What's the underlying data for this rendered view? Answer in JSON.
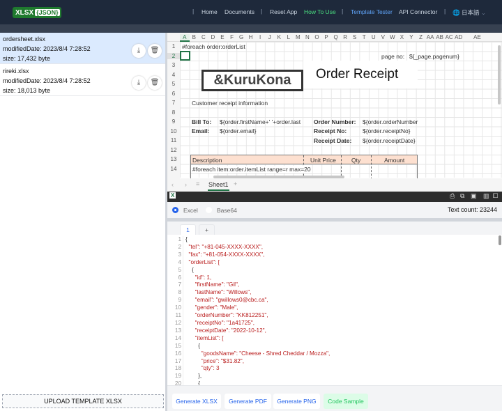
{
  "header": {
    "logo_main": "XLSX",
    "logo_badge": "{JSON}",
    "nav": [
      "Home",
      "Documents",
      "Reset App",
      "How To Use",
      "Template Tester",
      "API Connector"
    ],
    "language": "日本語",
    "colors": {
      "active": "#4ade80",
      "current": "#60a5fa"
    }
  },
  "files": [
    {
      "name": "ordersheet.xlsx",
      "modified": "modifiedDate: 2023/8/4 7:28:52",
      "size": "size: 17,432 byte",
      "selected": true
    },
    {
      "name": "rireki.xlsx",
      "modified": "modifiedDate: 2023/8/4 7:28:52",
      "size": "size: 18,013 byte",
      "selected": false
    }
  ],
  "upload_label": "UPLOAD TEMPLATE XLSX",
  "sheet": {
    "columns": [
      "A",
      "B",
      "C",
      "D",
      "E",
      "F",
      "G",
      "H",
      "I",
      "J",
      "K",
      "L",
      "M",
      "N",
      "O",
      "P",
      "Q",
      "R",
      "S",
      "T",
      "U",
      "V",
      "W",
      "X",
      "Y",
      "Z",
      "AA",
      "AB",
      "AC",
      "AD",
      "AE"
    ],
    "rows": [
      "1",
      "2",
      "3",
      "4",
      "5",
      "6",
      "7",
      "8",
      "9",
      "10",
      "11",
      "12",
      "13",
      "14"
    ],
    "cells": {
      "a1": "#foreach order:orderList",
      "page_no": "page no:",
      "page_num": "${_page.pagenum}",
      "brand": "&KuruKona",
      "title": "Order Receipt",
      "customer": "Customer receipt information",
      "bill_to": "Bill To:",
      "bill_to_val": "${order.firstName+' '+order.last",
      "email": "Email:",
      "email_val": "${order.email}",
      "order_number": "Order Number:",
      "order_number_val": "${order.orderNumber",
      "receipt_no": "Receipt No:",
      "receipt_no_val": "${order.receiptNo}",
      "receipt_date": "Receipt Date:",
      "receipt_date_val": "${order.receiptDate}"
    },
    "table_headers": [
      "Description",
      "Unit Price",
      "Qty",
      "Amount"
    ],
    "row14": "#foreach item:order.itemList range=r max=20",
    "tab": "Sheet1"
  },
  "output": {
    "options": [
      "Excel",
      "Base64"
    ],
    "selected": "Excel",
    "text_count": "Text count: 23244"
  },
  "editor": {
    "tabs": [
      "1",
      "+"
    ],
    "lines": [
      "{",
      "  \"tel\": \"+81-045-XXXX-XXXX\",",
      "  \"fax\": \"+81-054-XXXX-XXXX\",",
      "  \"orderList\": [",
      "    {",
      "      \"id\": 1,",
      "      \"firstName\": \"Gil\",",
      "      \"lastName\": \"Willows\",",
      "      \"email\": \"gwillows0@cbc.ca\",",
      "      \"gender\": \"Male\",",
      "      \"orderNumber\": \"KK812251\",",
      "      \"receiptNo\": \"1a41725\",",
      "      \"receiptDate\": \"2022-10-12\",",
      "      \"itemList\": [",
      "        {",
      "          \"goodsName\": \"Cheese - Shred Cheddar / Mozza\",",
      "          \"price\": \"$31.82\",",
      "          \"qty\": 3",
      "        },",
      "        {"
    ]
  },
  "actions": [
    "Generate XLSX",
    "Generate PDF",
    "Generate PNG",
    "Code Sample"
  ]
}
